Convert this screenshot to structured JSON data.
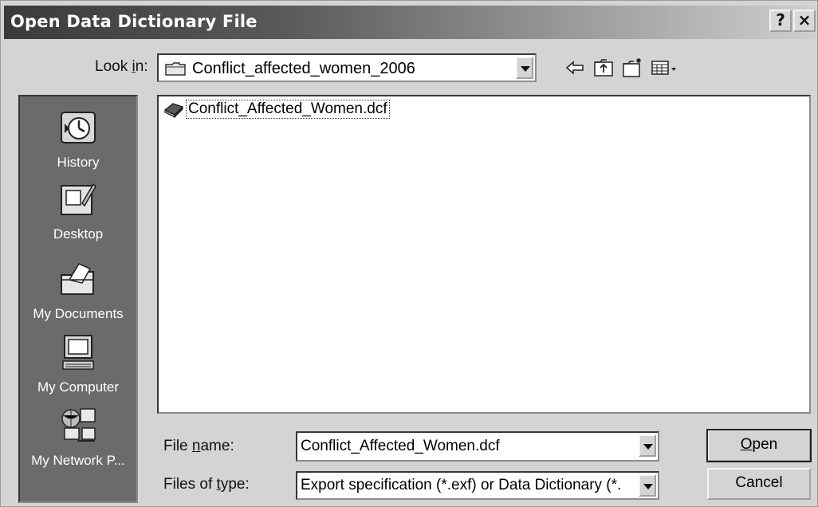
{
  "window": {
    "title": "Open Data Dictionary File",
    "help_button": "?",
    "close_button": "×"
  },
  "lookin": {
    "label_pre": "Look ",
    "label_accel": "i",
    "label_post": "n:",
    "value": "Conflict_affected_women_2006",
    "icon": "folder-icon"
  },
  "toolbar": {
    "items": [
      "back-icon",
      "up-folder-icon",
      "new-folder-icon",
      "view-menu-icon"
    ]
  },
  "places": {
    "items": [
      {
        "label": "History",
        "icon": "history-icon"
      },
      {
        "label": "Desktop",
        "icon": "desktop-icon"
      },
      {
        "label": "My Documents",
        "icon": "my-documents-icon"
      },
      {
        "label": "My Computer",
        "icon": "my-computer-icon"
      },
      {
        "label": "My Network P...",
        "icon": "network-places-icon"
      }
    ]
  },
  "files": {
    "items": [
      {
        "name": "Conflict_Affected_Women.dcf",
        "icon": "data-dictionary-file-icon"
      }
    ]
  },
  "filename": {
    "label_pre": "File ",
    "label_accel": "n",
    "label_post": "ame:",
    "value": "Conflict_Affected_Women.dcf"
  },
  "filetype": {
    "label_pre": "Files of ",
    "label_accel": "t",
    "label_post": "ype:",
    "value": "Export specification (*.exf) or Data Dictionary (*."
  },
  "buttons": {
    "open_accel": "O",
    "open_rest": "pen",
    "cancel": "Cancel"
  }
}
